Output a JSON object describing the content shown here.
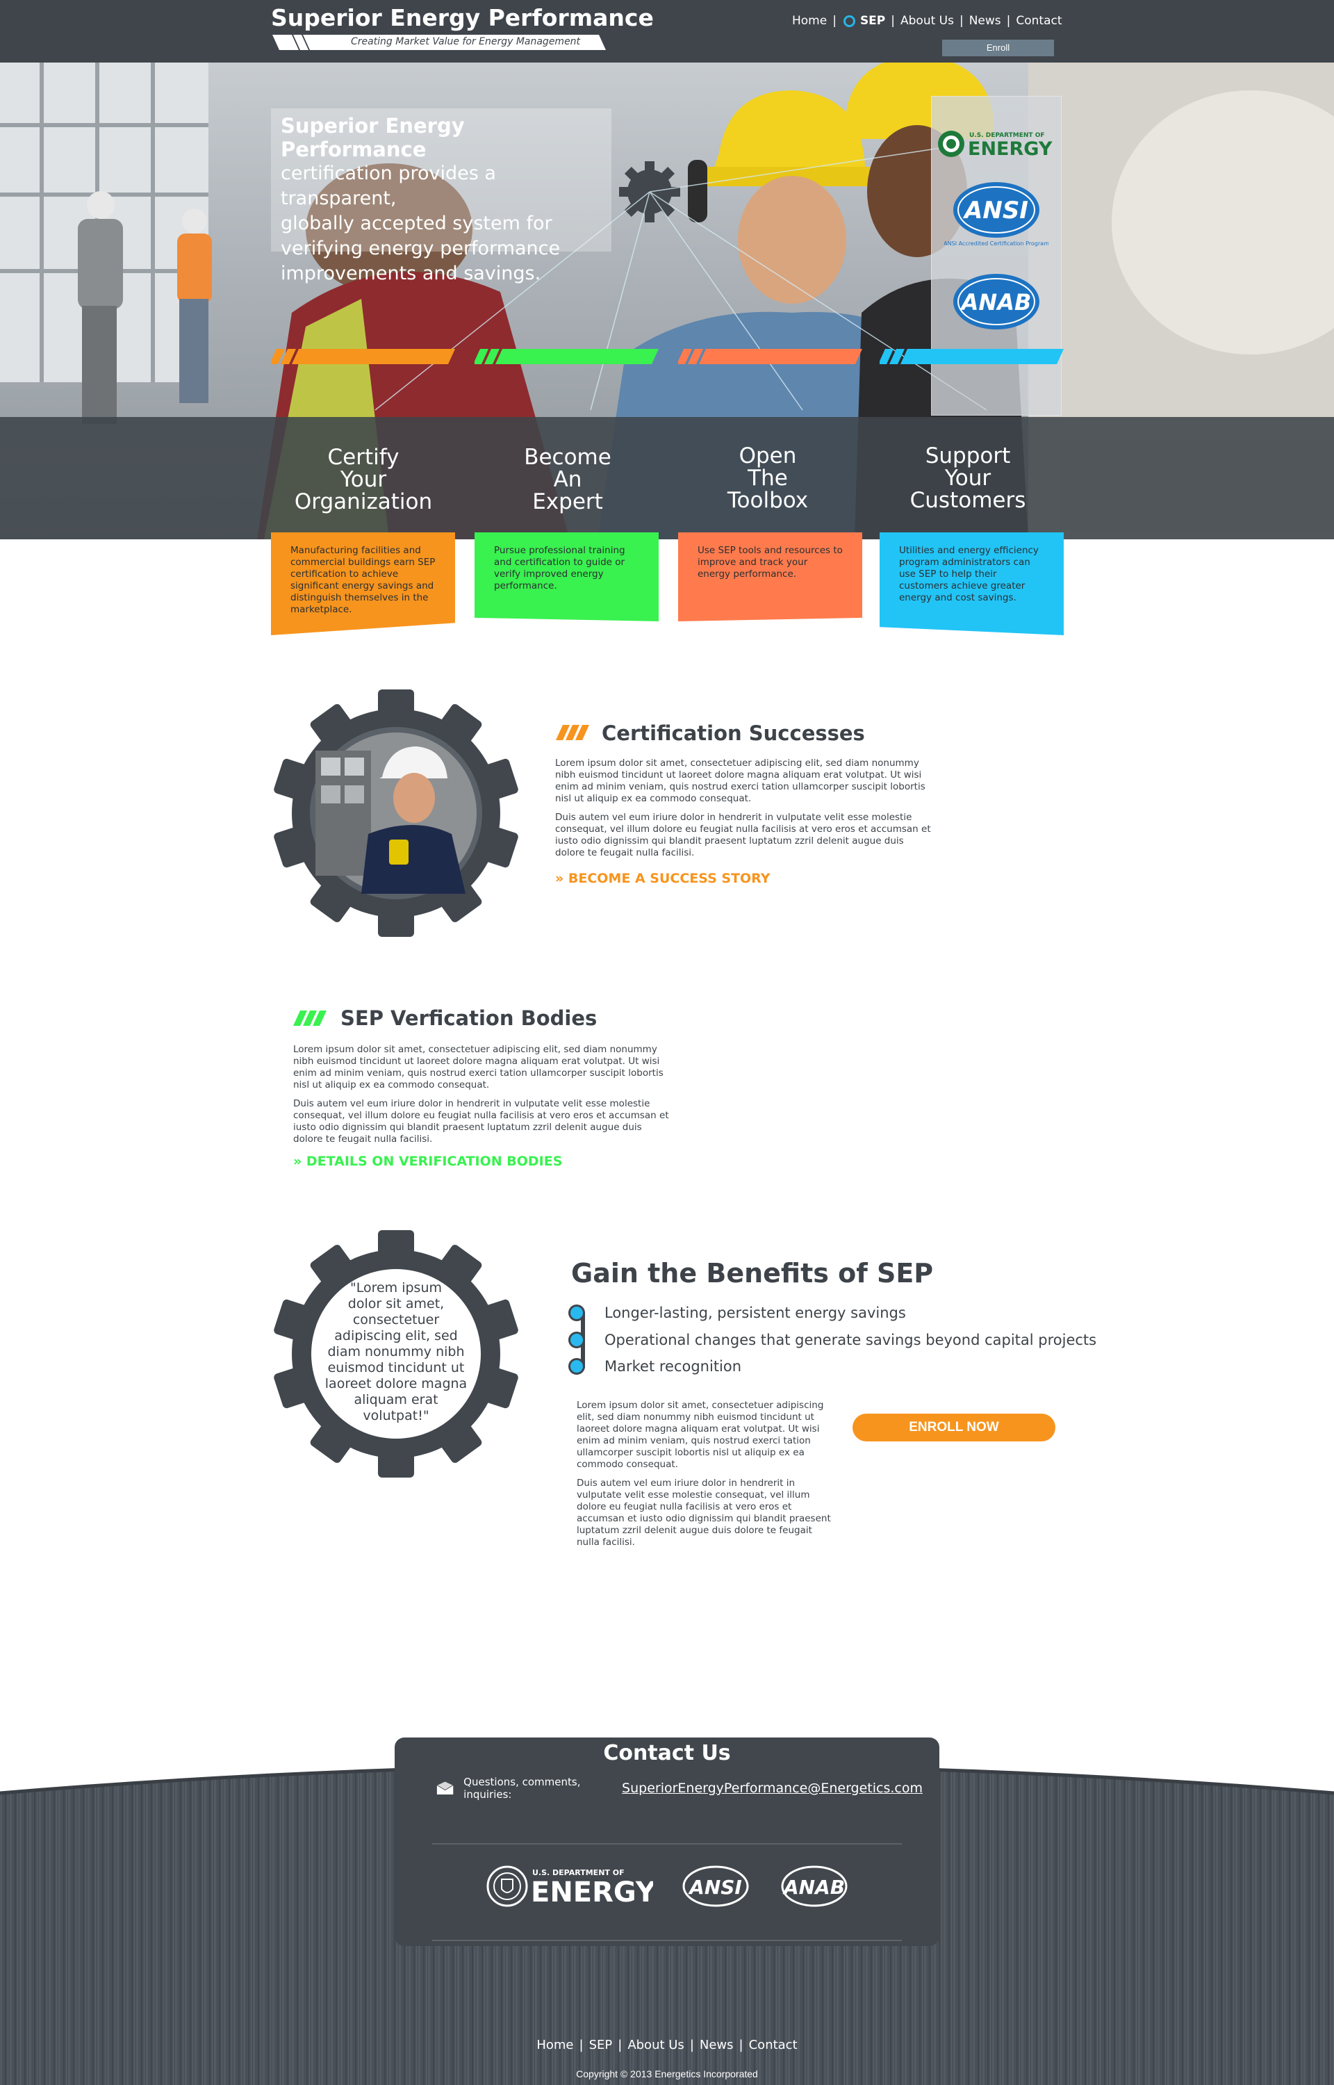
{
  "header": {
    "logo_title": "Superior Energy Performance",
    "logo_tagline": "Creating Market Value for Energy Management",
    "nav": [
      "Home",
      "SEP",
      "About Us",
      "News",
      "Contact"
    ],
    "active_nav": "SEP",
    "enroll_label": "Enroll"
  },
  "hero": {
    "caption_bold": "Superior Energy Performance",
    "caption_lines": [
      "certification provides a transparent,",
      "globally accepted system for",
      "verifying energy performance",
      "improvements and savings."
    ],
    "partners": {
      "doe_small": "U.S. DEPARTMENT OF",
      "doe_big": "ENERGY",
      "ansi": "ANSI",
      "ansi_sub": "ANSI Accredited Certification Program",
      "anab": "ANAB"
    }
  },
  "tiles": [
    {
      "title": [
        "Certify",
        "Your",
        "Organization"
      ],
      "text": "Manufacturing facilities and commercial buildings earn SEP certification to achieve significant energy savings and distinguish themselves in the marketplace.",
      "color": "#f7941d"
    },
    {
      "title": [
        "Become",
        "An",
        "Expert"
      ],
      "text": "Pursue professional training and certification to guide or verify improved energy performance.",
      "color": "#39f14f"
    },
    {
      "title": [
        "Open",
        "The",
        "Toolbox"
      ],
      "text": "Use SEP tools and resources to improve  and track your energy performance.",
      "color": "#ff7b4d"
    },
    {
      "title": [
        "Support",
        "Your",
        "Customers"
      ],
      "text": "Utilities and energy efficiency program administrators can use SEP to help their customers achieve greater energy and cost savings.",
      "color": "#22c4f5"
    }
  ],
  "certification": {
    "title": "Certification Successes",
    "p1": "Lorem ipsum dolor sit amet, consectetuer adipiscing elit, sed diam nonummy nibh euismod tincidunt ut laoreet dolore magna aliquam erat volutpat. Ut wisi enim ad minim veniam, quis nostrud exerci tation ullamcorper suscipit lobortis nisl ut aliquip ex ea commodo consequat.",
    "p2": "Duis autem vel eum iriure dolor in hendrerit in vulputate velit esse molestie consequat, vel illum dolore eu feugiat nulla facilisis at vero eros et accumsan et iusto odio dignissim qui blandit praesent luptatum zzril delenit augue duis dolore te feugait nulla facilisi.",
    "link": "» BECOME A SUCCESS STORY",
    "accent": "#f7941d"
  },
  "verification": {
    "title": "SEP Verfication Bodies",
    "p1": "Lorem ipsum dolor sit amet, consectetuer adipiscing elit, sed diam nonummy nibh euismod tincidunt ut laoreet dolore magna aliquam erat volutpat. Ut wisi enim ad minim veniam, quis nostrud exerci tation ullamcorper suscipit lobortis nisl ut aliquip ex ea commodo consequat.",
    "p2": "Duis autem vel eum iriure dolor in hendrerit in vulputate velit esse molestie consequat, vel illum dolore eu feugiat nulla facilisis at vero eros et accumsan et iusto odio dignissim qui blandit praesent luptatum zzril delenit augue duis dolore te feugait nulla facilisi.",
    "link": "» DETAILS ON VERIFICATION BODIES",
    "accent": "#39f14f"
  },
  "benefits": {
    "title": "Gain the Benefits of SEP",
    "quote_lines": [
      "\"Lorem ipsum",
      "dolor sit amet,",
      "consectetuer",
      "adipiscing elit, sed",
      "diam nonummy nibh",
      "euismod tincidunt ut",
      "laoreet dolore magna",
      "aliquam erat",
      "volutpat!\""
    ],
    "bullets": [
      "Longer-lasting, persistent energy savings",
      "Operational changes that generate savings beyond capital projects",
      "Market recognition"
    ],
    "p1": "Lorem ipsum dolor sit amet, consectetuer adipiscing elit, sed diam nonummy nibh euismod tincidunt ut laoreet dolore magna aliquam erat volutpat. Ut wisi enim ad minim veniam, quis nostrud exerci tation ullamcorper suscipit lobortis nisl ut aliquip ex ea commodo consequat.",
    "p2": "Duis autem vel eum iriure dolor in hendrerit in vulputate velit esse molestie consequat, vel illum dolore eu feugiat nulla facilisis at vero eros et accumsan et iusto odio dignissim qui blandit praesent luptatum zzril delenit augue duis dolore te feugait nulla facilisi.",
    "enroll_now": "ENROLL NOW",
    "accent": "#f7941d"
  },
  "footer": {
    "contact_title": "Contact Us",
    "contact_prompt": "Questions, comments, inquiries:",
    "contact_email": "SuperiorEnergyPerformance@Energetics.com",
    "logos": {
      "doe_small": "U.S. DEPARTMENT OF",
      "doe_big": "ENERGY",
      "ansi": "ANSI",
      "anab": "ANAB"
    },
    "nav": [
      "Home",
      "SEP",
      "About Us",
      "News",
      "Contact"
    ],
    "copyright": "Copyright © 2013 Energetics Incorporated"
  },
  "colors": {
    "header_bg": "#3f454b",
    "orange": "#f7941d",
    "green": "#39f14f",
    "coral": "#ff7b4d",
    "blue": "#22c4f5"
  }
}
